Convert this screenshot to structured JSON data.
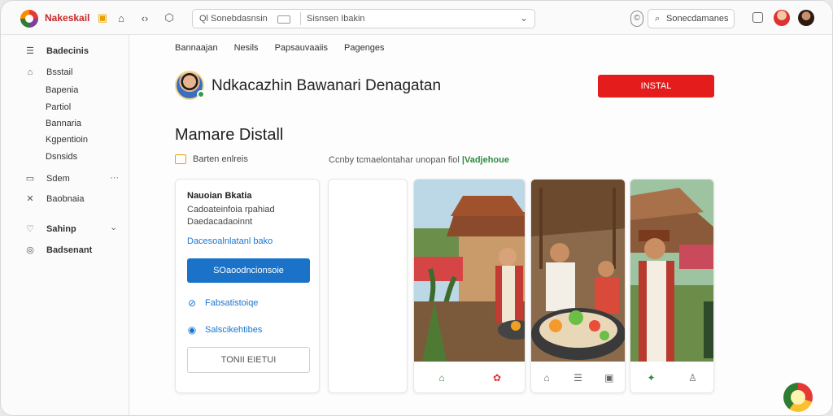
{
  "app": {
    "name": "Nakeskail",
    "brand_color": "#c62828"
  },
  "topbar": {
    "search_left": "Ql Sonebdasnsin",
    "search_right": "Sisnsen Ibakin",
    "search_small": "Sonecdamanes"
  },
  "sidebar": {
    "header": "Badecinis",
    "items": [
      {
        "label": "Bsstail",
        "icon": "home-icon"
      },
      {
        "label": "Bapenia"
      },
      {
        "label": "Partiol"
      },
      {
        "label": "Bannaria"
      },
      {
        "label": "Kgpentioin"
      },
      {
        "label": "Dsnsids"
      },
      {
        "label": "Sdem",
        "icon": "folder-icon",
        "extra": "···"
      },
      {
        "label": "Baobnaia",
        "icon": "tools-icon"
      },
      {
        "label": "Sahinp",
        "icon": "heart-icon",
        "extra": "⌄"
      },
      {
        "label": "Badsenant",
        "icon": "globe-icon"
      }
    ]
  },
  "tabs": [
    "Bannaajan",
    "Nesils",
    "Papsauvaaiis",
    "Pagenges"
  ],
  "profile": {
    "name": "Ndkacazhin Bawanari Denagatan",
    "install_label": "INSTAL"
  },
  "section": {
    "title": "Mamare Distall",
    "meta_left": "Barten enlreis",
    "meta_right_prefix": "Ccnby tcmaelontahar unopan  fiol",
    "meta_right_highlight": "Vadjehoue"
  },
  "card1": {
    "title": "Nauoian Bkatia",
    "line1": "Cadoateinfoia rpahiad",
    "line2": "Daedacadaoinnt",
    "link": "Dacesoalnlatanl bako",
    "primary_button": "SOaoodncionsoie",
    "item1": "Fabsatistoiqe",
    "item2": "Salscikehtibes",
    "outline_button": "TONII EIETUI"
  },
  "colors": {
    "install": "#e51c1c",
    "primary": "#1a73c8",
    "link": "#1976d2",
    "green": "#2e8b3e"
  }
}
